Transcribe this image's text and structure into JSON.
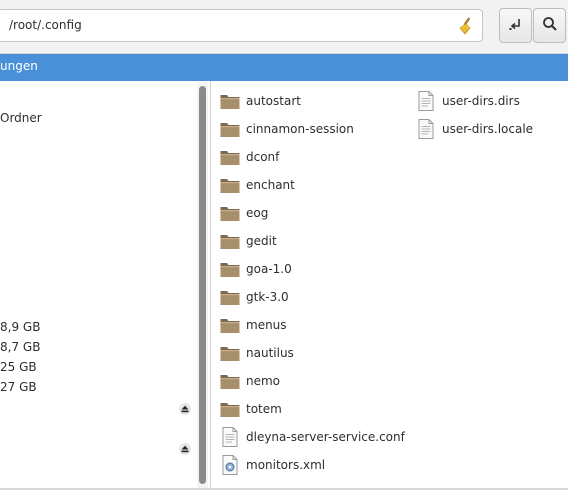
{
  "location": {
    "path": "/root/.config"
  },
  "header": {
    "text": "ungen"
  },
  "sidebar": {
    "items": [
      {
        "label": "Ordner"
      },
      {
        "label": "8,9 GB"
      },
      {
        "label": "8,7 GB"
      },
      {
        "label": "25 GB"
      },
      {
        "label": "27 GB"
      }
    ],
    "eject_icons": [
      "eject-icon",
      "eject-icon"
    ]
  },
  "files": {
    "column1": [
      {
        "name": "autostart",
        "icon": "folder-icon"
      },
      {
        "name": "cinnamon-session",
        "icon": "folder-icon"
      },
      {
        "name": "dconf",
        "icon": "folder-icon"
      },
      {
        "name": "enchant",
        "icon": "folder-icon"
      },
      {
        "name": "eog",
        "icon": "folder-icon"
      },
      {
        "name": "gedit",
        "icon": "folder-icon"
      },
      {
        "name": "goa-1.0",
        "icon": "folder-icon"
      },
      {
        "name": "gtk-3.0",
        "icon": "folder-icon"
      },
      {
        "name": "menus",
        "icon": "folder-icon"
      },
      {
        "name": "nautilus",
        "icon": "folder-icon"
      },
      {
        "name": "nemo",
        "icon": "folder-icon"
      },
      {
        "name": "totem",
        "icon": "folder-icon"
      },
      {
        "name": "dleyna-server-service.conf",
        "icon": "text-file-icon"
      },
      {
        "name": "monitors.xml",
        "icon": "xml-file-icon"
      }
    ],
    "column2": [
      {
        "name": "user-dirs.dirs",
        "icon": "text-file-icon"
      },
      {
        "name": "user-dirs.locale",
        "icon": "text-file-icon"
      }
    ]
  },
  "colors": {
    "accent": "#4a90d9",
    "folder": "#a88f6b"
  }
}
